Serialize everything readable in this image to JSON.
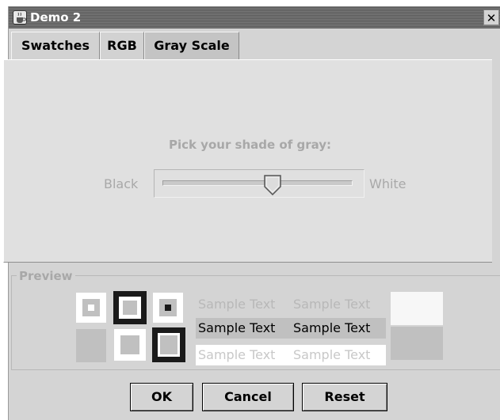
{
  "window": {
    "title": "Demo 2",
    "close_glyph": "✕",
    "app_icon": "java-cup-icon"
  },
  "tabs": [
    {
      "label": "Swatches",
      "selected": false
    },
    {
      "label": "RGB",
      "selected": false
    },
    {
      "label": "Gray Scale",
      "selected": true
    }
  ],
  "gray_scale": {
    "prompt": "Pick your shade of gray:",
    "min_label": "Black",
    "max_label": "White",
    "slider_value_fraction": 0.58,
    "enabled": false
  },
  "preview": {
    "title": "Preview",
    "sample_text": "Sample Text",
    "colors": {
      "selected_gray": "#c0c0c0",
      "white": "#ffffff",
      "black": "#1a1a1a",
      "disabled_text": "#b8b8b8",
      "highlight": "#c0c0c0"
    }
  },
  "buttons": {
    "ok": "OK",
    "cancel": "Cancel",
    "reset": "Reset"
  }
}
